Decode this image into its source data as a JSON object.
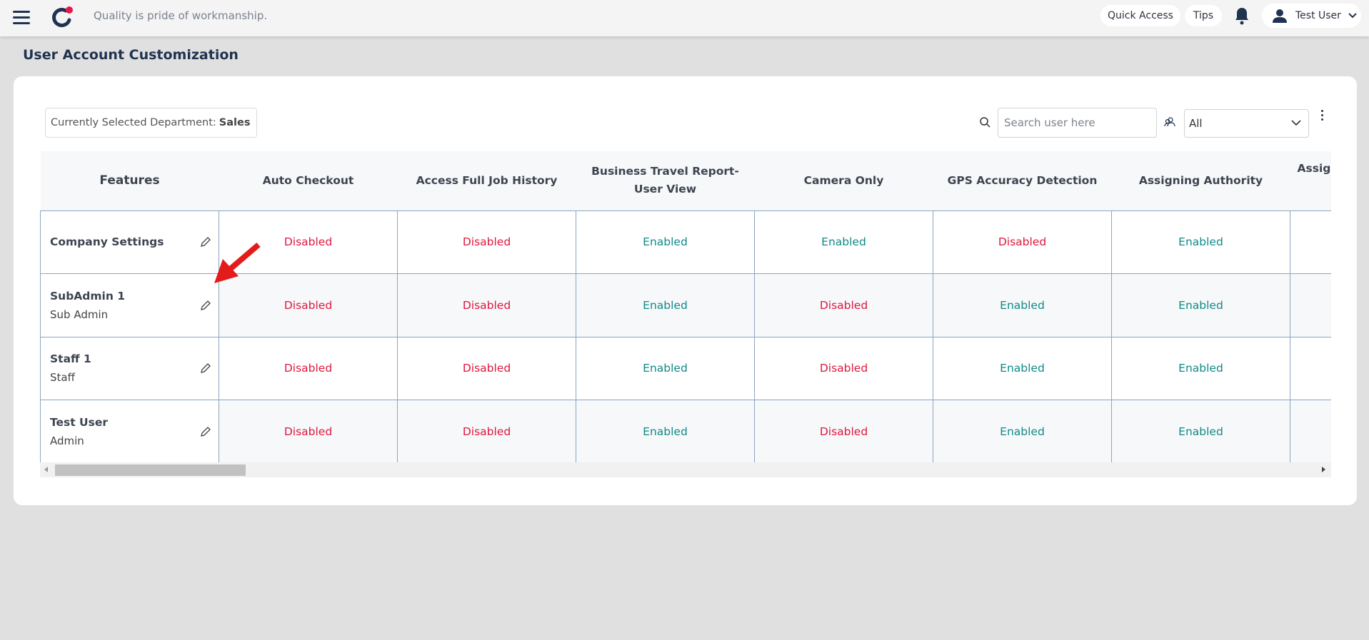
{
  "header": {
    "tagline": "Quality is pride of workmanship.",
    "quick_access": "Quick Access",
    "tips": "Tips",
    "user": "Test User"
  },
  "page": {
    "title": "User Account Customization"
  },
  "toolbar": {
    "dept_label": "Currently Selected Department:",
    "dept_value": "Sales",
    "search_placeholder": "Search user here",
    "filter_value": "All"
  },
  "table": {
    "columns": [
      "Features",
      "Auto Checkout",
      "Access Full Job History",
      "Business Travel Report-User View",
      "Camera Only",
      "GPS Accuracy Detection",
      "Assigning Authority",
      "Assign"
    ],
    "rows": [
      {
        "name": "Company Settings",
        "role": "",
        "values": [
          "Disabled",
          "Disabled",
          "Enabled",
          "Enabled",
          "Disabled",
          "Enabled"
        ]
      },
      {
        "name": "SubAdmin 1",
        "role": "Sub Admin",
        "values": [
          "Disabled",
          "Disabled",
          "Enabled",
          "Disabled",
          "Enabled",
          "Enabled"
        ]
      },
      {
        "name": "Staff 1",
        "role": "Staff",
        "values": [
          "Disabled",
          "Disabled",
          "Enabled",
          "Disabled",
          "Enabled",
          "Enabled"
        ]
      },
      {
        "name": "Test User",
        "role": "Admin",
        "values": [
          "Disabled",
          "Disabled",
          "Enabled",
          "Disabled",
          "Enabled",
          "Enabled"
        ]
      }
    ]
  },
  "colors": {
    "enabled": "#0f8a87",
    "disabled": "#e0163c",
    "brand_navy": "#1f3350",
    "brand_red": "#e8174a",
    "annotation_arrow": "#e31b1b"
  }
}
